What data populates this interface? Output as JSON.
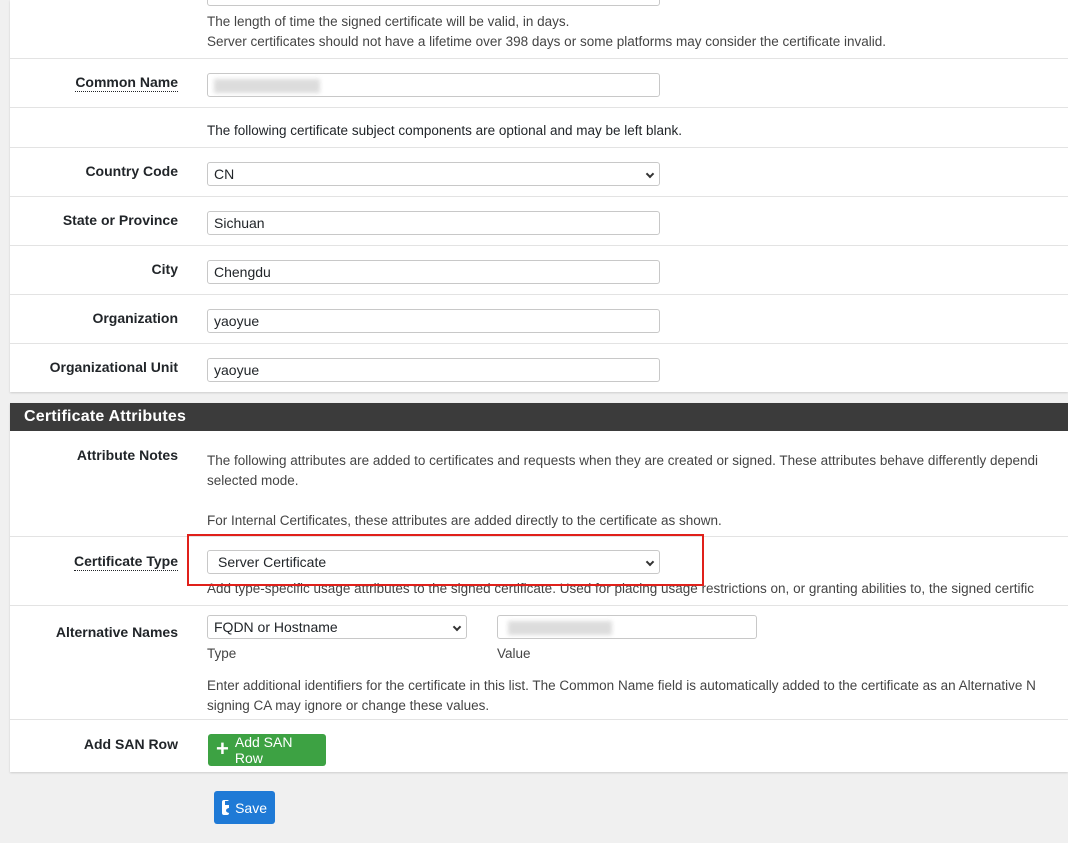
{
  "subject": {
    "lifetime_help_line1": "The length of time the signed certificate will be valid, in days.",
    "lifetime_help_line2": "Server certificates should not have a lifetime over 398 days or some platforms may consider the certificate invalid.",
    "common_name_label": "Common Name",
    "common_name_value": "",
    "optional_note": "The following certificate subject components are optional and may be left blank.",
    "country_code_label": "Country Code",
    "country_code_value": "CN",
    "state_label": "State or Province",
    "state_value": "Sichuan",
    "city_label": "City",
    "city_value": "Chengdu",
    "organization_label": "Organization",
    "organization_value": "yaoyue",
    "org_unit_label": "Organizational Unit",
    "org_unit_value": "yaoyue"
  },
  "attributes": {
    "section_title": "Certificate Attributes",
    "notes_label": "Attribute Notes",
    "notes_line1": "The following attributes are added to certificates and requests when they are created or signed. These attributes behave differently dependi",
    "notes_line2": "selected mode.",
    "notes_line3": "For Internal Certificates, these attributes are added directly to the certificate as shown.",
    "cert_type_label": "Certificate Type",
    "cert_type_value": "Server Certificate",
    "cert_type_help": "Add type-specific usage attributes to the signed certificate. Used for placing usage restrictions on, or granting abilities to, the signed certific",
    "alt_names_label": "Alternative Names",
    "alt_type_value": "FQDN or Hostname",
    "alt_value_value": "",
    "alt_type_caption": "Type",
    "alt_value_caption": "Value",
    "alt_help_line1": "Enter additional identifiers for the certificate in this list. The Common Name field is automatically added to the certificate as an Alternative N",
    "alt_help_line2": "signing CA may ignore or change these values.",
    "add_san_label": "Add SAN Row",
    "add_san_button": "Add SAN Row"
  },
  "footer": {
    "save_button": "Save"
  },
  "colors": {
    "header_bg": "#3b3b3b",
    "add_button": "#3da243",
    "save_button": "#1f7ad6",
    "highlight_border": "#e0201a"
  }
}
